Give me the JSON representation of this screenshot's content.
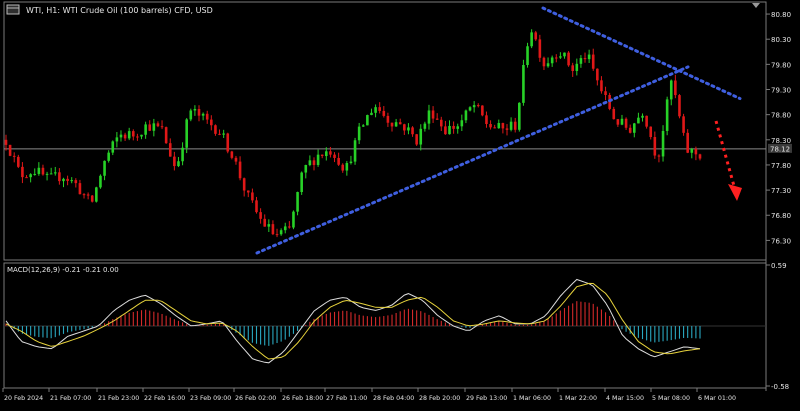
{
  "title": "WTI, H1:  WTI Crude Oil (100 barrels) CFD, USD",
  "current_price": "78.12",
  "colors": {
    "background": "#000000",
    "frame": "#7a7a7a",
    "text": "#e6e6e6",
    "bull": "#27d127",
    "bear": "#e01818",
    "trendline": "#3f5fe0",
    "arrow": "#ff2020",
    "macd_pos": "#d42a2a",
    "macd_neg": "#2aa8c0",
    "macd_line": "#dcdcdc",
    "signal_line": "#e6d23c"
  },
  "chart_data": [
    {
      "type": "candlestick",
      "panel": "price",
      "symbol": "WTI",
      "timeframe": "H1",
      "ylim": [
        75.95,
        81.0
      ],
      "y_ticks": [
        "80.80",
        "80.30",
        "79.80",
        "79.30",
        "78.80",
        "78.30",
        "77.80",
        "77.30",
        "76.80",
        "76.30"
      ],
      "x_ticks": [
        "20 Feb 2024",
        "21 Feb 07:00",
        "21 Feb 23:00",
        "22 Feb 16:00",
        "23 Feb 09:00",
        "26 Feb 02:00",
        "26 Feb 18:00",
        "27 Feb 11:00",
        "28 Feb 04:00",
        "28 Feb 20:00",
        "29 Feb 13:00",
        "1 Mar 06:00",
        "1 Mar 22:00",
        "4 Mar 15:00",
        "5 Mar 08:00",
        "6 Mar 01:00"
      ],
      "close_path": [
        78.3,
        77.6,
        77.7,
        77.5,
        77.6,
        77.4,
        77.0,
        77.9,
        78.4,
        78.4,
        78.6,
        78.5,
        77.7,
        78.9,
        78.7,
        78.5,
        78.0,
        77.2,
        76.7,
        76.4,
        76.5,
        77.7,
        78.0,
        78.1,
        77.7,
        78.5,
        79.0,
        78.7,
        78.6,
        78.3,
        78.9,
        78.5,
        78.6,
        79.0,
        78.6,
        78.5,
        78.6,
        80.6,
        79.8,
        80.1,
        79.7,
        80.0,
        79.3,
        78.7,
        78.5,
        78.9,
        77.9,
        79.5,
        78.1,
        78.0
      ],
      "current_price": 78.12,
      "annotations": [
        {
          "type": "trendline",
          "style": "dotted",
          "points": [
            [
              "26 Feb 02:00",
              76.05
            ],
            [
              "5 Mar 10:00",
              79.7
            ]
          ]
        },
        {
          "type": "trendline",
          "style": "dotted",
          "points": [
            [
              "1 Mar 06:00",
              80.9
            ],
            [
              "6 Mar 12:00",
              79.1
            ]
          ]
        },
        {
          "type": "arrow",
          "style": "dotted",
          "direction": "down"
        }
      ]
    },
    {
      "type": "histogram+line",
      "panel": "indicator",
      "label": "MACD(12,26,9) -0.21 -0.21 0.00",
      "y_ticks": [
        "0.59",
        "-0.58"
      ],
      "ylim": [
        -0.58,
        0.59
      ],
      "series": [
        {
          "name": "MACD",
          "values": [
            0.05,
            -0.15,
            -0.2,
            -0.22,
            -0.1,
            -0.05,
            0.0,
            0.15,
            0.25,
            0.3,
            0.22,
            0.1,
            0.0,
            0.02,
            0.05,
            -0.15,
            -0.32,
            -0.36,
            -0.25,
            -0.05,
            0.15,
            0.25,
            0.28,
            0.18,
            0.15,
            0.2,
            0.32,
            0.25,
            0.1,
            0.0,
            -0.05,
            0.05,
            0.1,
            0.02,
            0.02,
            0.1,
            0.3,
            0.45,
            0.4,
            0.2,
            -0.1,
            -0.22,
            -0.3,
            -0.25,
            -0.2,
            -0.22
          ]
        },
        {
          "name": "Signal",
          "values": [
            0.02,
            -0.05,
            -0.15,
            -0.2,
            -0.15,
            -0.1,
            -0.03,
            0.05,
            0.15,
            0.25,
            0.25,
            0.15,
            0.05,
            0.02,
            0.03,
            -0.05,
            -0.2,
            -0.32,
            -0.3,
            -0.15,
            0.05,
            0.18,
            0.25,
            0.22,
            0.18,
            0.18,
            0.25,
            0.28,
            0.18,
            0.05,
            0.0,
            0.02,
            0.05,
            0.03,
            0.02,
            0.05,
            0.2,
            0.38,
            0.42,
            0.3,
            0.05,
            -0.15,
            -0.25,
            -0.27,
            -0.24,
            -0.22
          ]
        }
      ]
    }
  ]
}
